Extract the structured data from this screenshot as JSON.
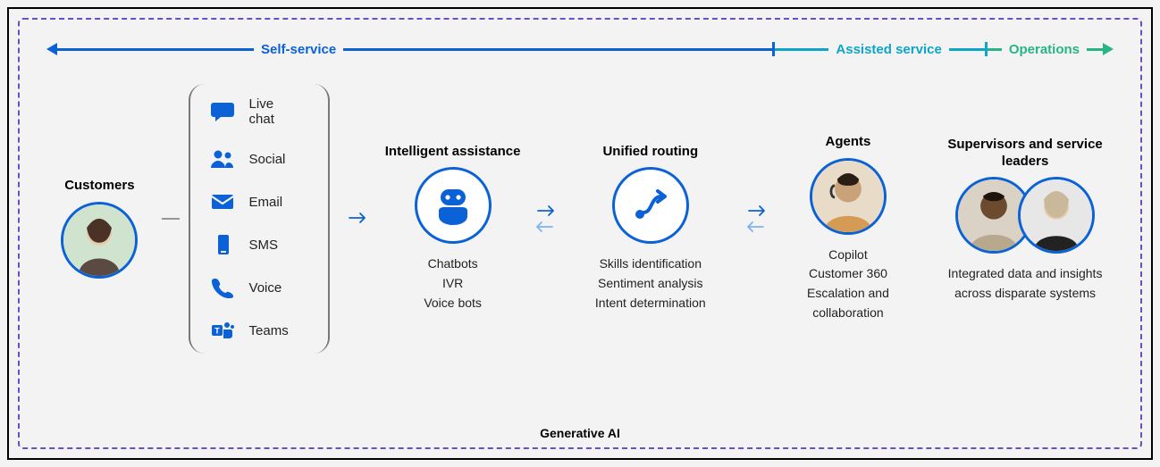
{
  "track": {
    "self_service": "Self-service",
    "assisted_service": "Assisted service",
    "operations": "Operations"
  },
  "customers": {
    "title": "Customers"
  },
  "channels": {
    "items": [
      {
        "icon": "chat-bubble-icon",
        "label": "Live chat"
      },
      {
        "icon": "people-icon",
        "label": "Social"
      },
      {
        "icon": "envelope-icon",
        "label": "Email"
      },
      {
        "icon": "phone-rect-icon",
        "label": "SMS"
      },
      {
        "icon": "handset-icon",
        "label": "Voice"
      },
      {
        "icon": "teams-icon",
        "label": "Teams"
      }
    ]
  },
  "intelligent": {
    "title": "Intelligent assistance",
    "items": [
      "Chatbots",
      "IVR",
      "Voice bots"
    ]
  },
  "routing": {
    "title": "Unified routing",
    "items": [
      "Skills identification",
      "Sentiment analysis",
      "Intent determination"
    ]
  },
  "agents": {
    "title": "Agents",
    "items": [
      "Copilot",
      "Customer 360",
      "Escalation and collaboration"
    ]
  },
  "leaders": {
    "title": "Supervisors and service leaders",
    "desc": "Integrated data and insights across disparate systems"
  },
  "footer": "Generative AI"
}
